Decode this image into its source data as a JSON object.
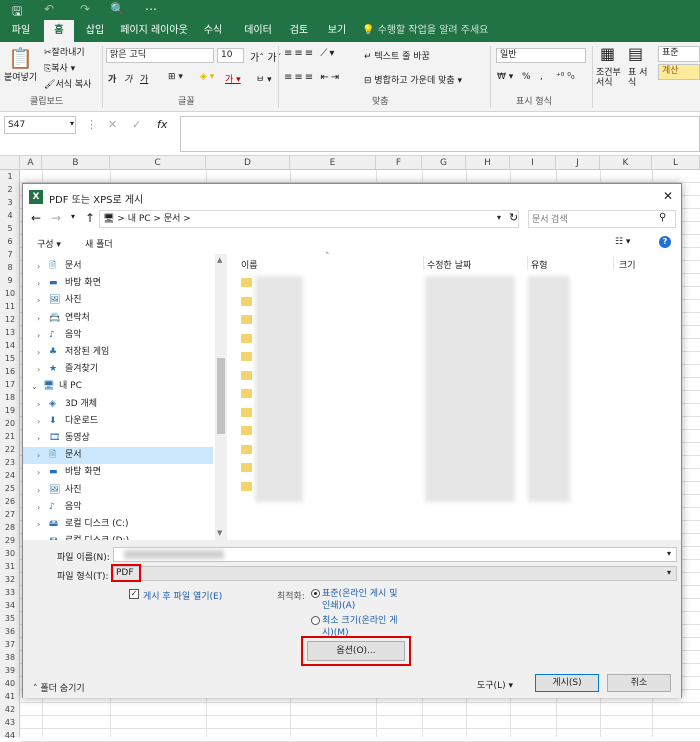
{
  "qat": {
    "save": "🖫",
    "undo": "↶",
    "redo": "↷",
    "preview": "🔍",
    "more": "⋯"
  },
  "tabs": [
    "파일",
    "홈",
    "삽입",
    "페이지 레이아웃",
    "수식",
    "데이터",
    "검토",
    "보기"
  ],
  "tell_me": "수행할 작업을 알려 주세요",
  "ribbon": {
    "paste": "붙여넣기",
    "cut": "잘라내기",
    "copy": "복사",
    "format_painter": "서식 복사",
    "clipboard": "클립보드",
    "font_name": "맑은 고딕",
    "font_size": "10",
    "font": "글꼴",
    "bold": "가",
    "italic": "가",
    "underline": "가",
    "wrap": "텍스트 줄 바꿈",
    "merge": "병합하고 가운데 맞춤",
    "align": "맞춤",
    "number_format": "일반",
    "currency": "₩",
    "percent": "%",
    "comma": ",",
    "number": "표시 형식",
    "cond": "조건부 서식",
    "table": "표 서식",
    "style_normal": "표준",
    "style_calc": "계산"
  },
  "formula": {
    "namebox": "S47",
    "fx": "fx"
  },
  "columns": [
    "A",
    "B",
    "C",
    "D",
    "E",
    "F",
    "G",
    "H",
    "I",
    "J",
    "K",
    "L"
  ],
  "rows": [
    "1",
    "2",
    "3",
    "4",
    "5",
    "6",
    "7",
    "8",
    "9",
    "10",
    "11",
    "12",
    "13",
    "14",
    "15",
    "16",
    "17",
    "18",
    "19",
    "20",
    "21",
    "22",
    "23",
    "24",
    "25",
    "26",
    "27",
    "28",
    "29",
    "30",
    "31",
    "32",
    "33",
    "34",
    "35",
    "36",
    "37",
    "38",
    "39",
    "40",
    "41",
    "42",
    "43",
    "44"
  ],
  "dialog": {
    "title": "PDF 또는 XPS로 게시",
    "close": "✕",
    "path": [
      "내 PC",
      "문서"
    ],
    "search_placeholder": "문서 검색",
    "organize": "구성",
    "new_folder": "새 폴더",
    "nav": [
      {
        "label": "문서",
        "indent": 1
      },
      {
        "label": "바탕 화면",
        "indent": 1
      },
      {
        "label": "사진",
        "indent": 1
      },
      {
        "label": "연락처",
        "indent": 1
      },
      {
        "label": "음악",
        "indent": 1
      },
      {
        "label": "저장된 게임",
        "indent": 1
      },
      {
        "label": "즐겨찾기",
        "indent": 1
      },
      {
        "label": "내 PC",
        "indent": 0
      },
      {
        "label": "3D 개체",
        "indent": 1
      },
      {
        "label": "다운로드",
        "indent": 1
      },
      {
        "label": "동영상",
        "indent": 1
      },
      {
        "label": "문서",
        "indent": 1,
        "selected": true
      },
      {
        "label": "바탕 화면",
        "indent": 1
      },
      {
        "label": "사진",
        "indent": 1
      },
      {
        "label": "음악",
        "indent": 1
      },
      {
        "label": "로컬 디스크 (C:)",
        "indent": 1
      },
      {
        "label": "로컬 디스크 (D:)",
        "indent": 1
      }
    ],
    "col_name": "이름",
    "col_date": "수정한 날짜",
    "col_type": "유형",
    "col_size": "크기",
    "filename_label": "파일 이름(N):",
    "filetype_label": "파일 형식(T):",
    "filetype_value": "PDF",
    "open_after": "게시 후 파일 열기(E)",
    "optimize_label": "최적화:",
    "opt_standard": "표준(온라인 게시 및 인쇄)(A)",
    "opt_minimum": "최소 크기(온라인 게시)(M)",
    "options_btn": "옵션(O)...",
    "hide_folders": "폴더 숨기기",
    "tools": "도구(L)",
    "publish": "게시(S)",
    "cancel": "취소"
  }
}
